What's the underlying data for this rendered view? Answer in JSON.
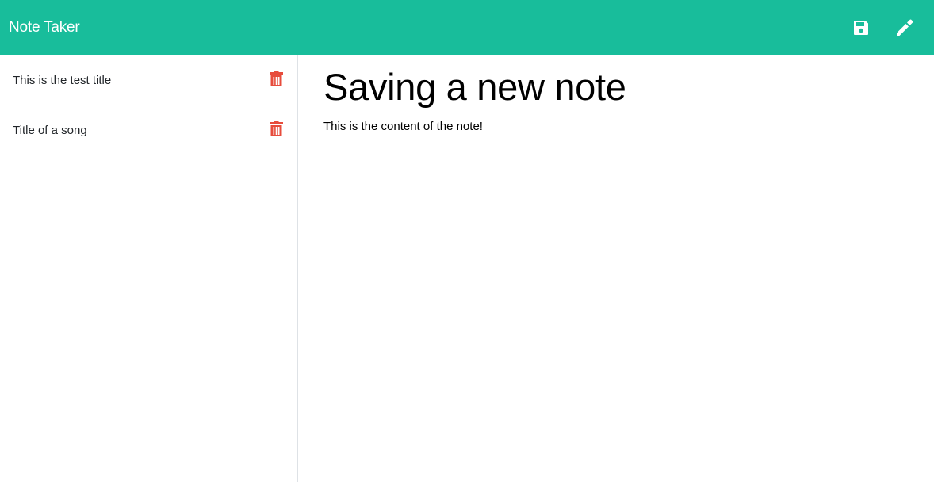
{
  "navbar": {
    "brand": "Note Taker",
    "save_icon": "floppy-disk-icon",
    "edit_icon": "pencil-icon",
    "background_color": "#18bd9b",
    "icon_color": "#ffffff"
  },
  "sidebar": {
    "notes": [
      {
        "title": "This is the test title",
        "delete_icon": "trash-icon"
      },
      {
        "title": "Title of a song",
        "delete_icon": "trash-icon"
      }
    ],
    "delete_color": "#e74c3c"
  },
  "editor": {
    "title": "Saving a new note",
    "content": "This is the content of the note!"
  }
}
